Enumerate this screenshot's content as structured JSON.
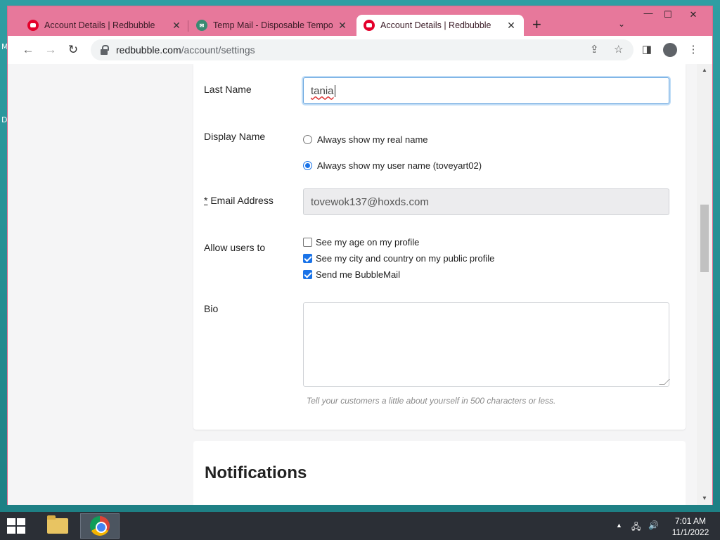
{
  "desktop": {
    "edge_letters": [
      "M",
      "D"
    ]
  },
  "browser": {
    "tabs": [
      {
        "title": "Account Details | Redbubble",
        "favicon": "redbubble-icon",
        "active": false
      },
      {
        "title": "Temp Mail - Disposable Tempora",
        "favicon": "tempmail-icon",
        "active": false
      },
      {
        "title": "Account Details | Redbubble",
        "favicon": "redbubble-icon",
        "active": true
      }
    ],
    "address_bar": {
      "host": "redbubble.com",
      "path": "/account/settings"
    }
  },
  "form": {
    "last_name": {
      "label": "Last Name",
      "value": "tania"
    },
    "display_name": {
      "label": "Display Name",
      "options": [
        {
          "label": "Always show my real name",
          "selected": false
        },
        {
          "label": "Always show my user name (toveyart02)",
          "selected": true
        }
      ]
    },
    "email": {
      "required_mark": "*",
      "label": "Email Address",
      "value": "tovewok137@hoxds.com"
    },
    "allow_users": {
      "label": "Allow users to",
      "options": [
        {
          "label": "See my age on my profile",
          "checked": false
        },
        {
          "label": "See my city and country on my public profile",
          "checked": true
        },
        {
          "label": "Send me BubbleMail",
          "checked": true
        }
      ]
    },
    "bio": {
      "label": "Bio",
      "value": "",
      "hint": "Tell your customers a little about yourself in 500 characters or less."
    }
  },
  "notifications": {
    "heading": "Notifications"
  },
  "taskbar": {
    "time": "7:01 AM",
    "date": "11/1/2022",
    "apps": [
      {
        "name": "File Explorer",
        "icon": "folder-icon",
        "active": false
      },
      {
        "name": "Google Chrome",
        "icon": "chrome-icon",
        "active": true
      }
    ]
  },
  "colors": {
    "window_frame": "#e7789b",
    "accent": "#1a73e8",
    "taskbar": "#2b2f36"
  }
}
